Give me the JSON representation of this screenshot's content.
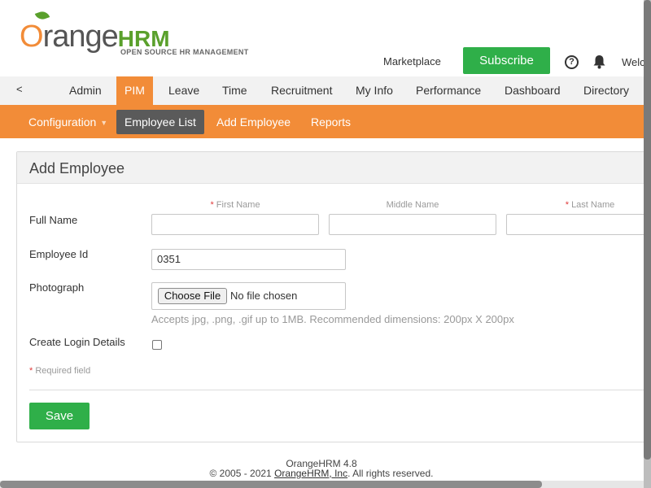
{
  "header": {
    "logo_text_o": "O",
    "logo_text_range": "range",
    "logo_text_hrm": "HRM",
    "logo_tagline": "OPEN SOURCE HR MANAGEMENT",
    "marketplace": "Marketplace",
    "subscribe": "Subscribe",
    "help_glyph": "?",
    "welcome": "Welc"
  },
  "mainnav": {
    "back": "<",
    "items": [
      "Admin",
      "PIM",
      "Leave",
      "Time",
      "Recruitment",
      "My Info",
      "Performance",
      "Dashboard",
      "Directory"
    ],
    "active": "PIM"
  },
  "subnav": {
    "items": [
      "Configuration",
      "Employee List",
      "Add Employee",
      "Reports"
    ],
    "caret": "▼",
    "active": "Employee List"
  },
  "form": {
    "title": "Add Employee",
    "full_name_label": "Full Name",
    "first_name_label": "First Name",
    "middle_name_label": "Middle Name",
    "last_name_label": "Last Name",
    "required_mark": "*",
    "first_name_value": "",
    "middle_name_value": "",
    "last_name_value": "",
    "employee_id_label": "Employee Id",
    "employee_id_value": "0351",
    "photograph_label": "Photograph",
    "choose_file": "Choose File",
    "no_file": "No file chosen",
    "photo_hint": "Accepts jpg, .png, .gif up to 1MB. Recommended dimensions: 200px X 200px",
    "create_login_label": "Create Login Details",
    "create_login_checked": false,
    "required_field_note": "Required field",
    "save": "Save"
  },
  "footer": {
    "version": "OrangeHRM 4.8",
    "copyright_prefix": "© 2005 - 2021 ",
    "company_link": "OrangeHRM, Inc",
    "copyright_suffix": ". All rights reserved."
  },
  "colors": {
    "brand_orange": "#f28c38",
    "brand_green": "#2faf49",
    "active_subnav": "#5a5a5a"
  }
}
